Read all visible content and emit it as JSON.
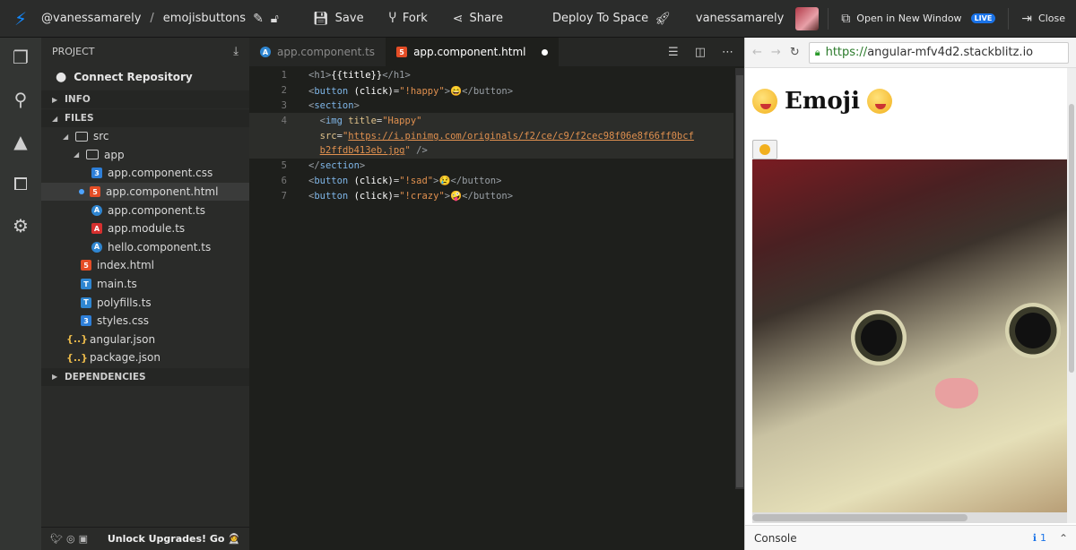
{
  "topbar": {
    "owner": "@vanessamarely",
    "separator": "/",
    "project": "emojisbuttons",
    "save_label": "Save",
    "fork_label": "Fork",
    "share_label": "Share",
    "deploy_label": "Deploy To Space",
    "username": "vanessamarely",
    "open_new_window_label": "Open in New Window",
    "live_badge": "LIVE",
    "close_label": "Close"
  },
  "sidebar": {
    "project_header": "PROJECT",
    "connect_repo": "Connect Repository",
    "info_label": "INFO",
    "files_label": "FILES",
    "tree": [
      {
        "label": "src",
        "type": "folder",
        "depth": 1,
        "open": true
      },
      {
        "label": "app",
        "type": "folder",
        "depth": 2,
        "open": true
      },
      {
        "label": "app.component.css",
        "type": "css",
        "depth": 3
      },
      {
        "label": "app.component.html",
        "type": "html",
        "depth": 3,
        "selected": true,
        "modified": true
      },
      {
        "label": "app.component.ts",
        "type": "ts",
        "depth": 3
      },
      {
        "label": "app.module.ts",
        "type": "ng",
        "depth": 3
      },
      {
        "label": "hello.component.ts",
        "type": "ts",
        "depth": 3
      },
      {
        "label": "index.html",
        "type": "html",
        "depth": 2
      },
      {
        "label": "main.ts",
        "type": "main",
        "depth": 2
      },
      {
        "label": "polyfills.ts",
        "type": "main",
        "depth": 2
      },
      {
        "label": "styles.css",
        "type": "css",
        "depth": 2
      },
      {
        "label": "angular.json",
        "type": "json",
        "depth": 1
      },
      {
        "label": "package.json",
        "type": "json",
        "depth": 1
      }
    ],
    "dependencies_label": "DEPENDENCIES",
    "footer_upgrade": "Unlock Upgrades! Go"
  },
  "editor": {
    "tabs": [
      {
        "label": "app.component.ts",
        "active": false
      },
      {
        "label": "app.component.html",
        "active": true
      }
    ],
    "code_lines": [
      "1",
      "2",
      "3",
      "4",
      "",
      "5",
      "6",
      "7"
    ]
  },
  "preview": {
    "url_https": "https://",
    "url_host": "angular-mfv4d2.stackblitz.io",
    "heading": "Emoji",
    "console_label": "Console",
    "console_count": "1"
  },
  "colors": {
    "accent": "#1389fd",
    "live_badge": "#1a73e8",
    "html_icon": "#e44d26",
    "css_icon": "#2e7fd8"
  }
}
